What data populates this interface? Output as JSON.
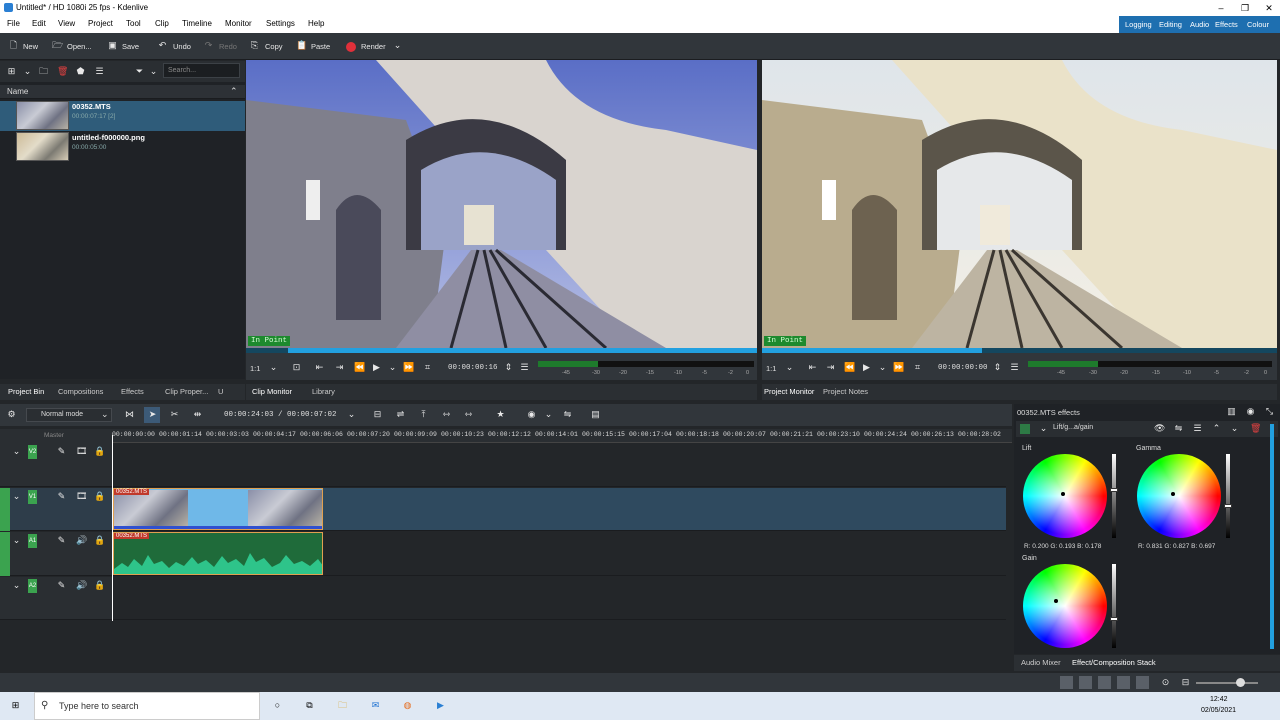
{
  "window": {
    "title": "Untitled* / HD 1080i 25 fps - Kdenlive"
  },
  "menu": [
    "File",
    "Edit",
    "View",
    "Project",
    "Tool",
    "Clip",
    "Timeline",
    "Monitor",
    "Settings",
    "Help"
  ],
  "layouts": [
    "Logging",
    "Editing",
    "Audio",
    "Effects",
    "Colour"
  ],
  "toolbar": {
    "new": "New",
    "open": "Open...",
    "save": "Save",
    "undo": "Undo",
    "redo": "Redo",
    "copy": "Copy",
    "paste": "Paste",
    "render": "Render"
  },
  "bin": {
    "search_placeholder": "Search...",
    "header": "Name",
    "items": [
      {
        "name": "00352.MTS",
        "sub": "00:00:07:17 [2]"
      },
      {
        "name": "untitled-f000000.png",
        "sub": "00:00:05:00"
      }
    ]
  },
  "clip_monitor": {
    "overlay": "In Point",
    "zoom": "1:1",
    "timecode": "00:00:00:16",
    "scale": [
      "-45",
      "-30",
      "-20",
      "-15",
      "-10",
      "-5",
      "-2",
      "0"
    ]
  },
  "project_monitor": {
    "overlay": "In Point",
    "zoom": "1:1",
    "timecode": "00:00:00:00",
    "scale": [
      "-45",
      "-30",
      "-20",
      "-15",
      "-10",
      "-5",
      "-2",
      "0"
    ]
  },
  "left_tabs": [
    "Project Bin",
    "Compositions",
    "Effects",
    "Clip Proper...",
    "U"
  ],
  "clip_tabs": [
    "Clip Monitor",
    "Library"
  ],
  "proj_tabs": [
    "Project Monitor",
    "Project Notes"
  ],
  "timeline": {
    "mode": "Normal mode",
    "position": "00:00:24:03 / 00:00:07:02",
    "master": "Master",
    "ruler": [
      "00:00:00:00",
      "00:00:01:14",
      "00:00:03:03",
      "00:00:04:17",
      "00:00:06:06",
      "00:00:07:20",
      "00:00:09:09",
      "00:00:10:23",
      "00:00:12:12",
      "00:00:14:01",
      "00:00:15:15",
      "00:00:17:04",
      "00:00:18:18",
      "00:00:20:07",
      "00:00:21:21",
      "00:00:23:10",
      "00:00:24:24",
      "00:00:26:13",
      "00:00:28:02"
    ],
    "tracks": [
      {
        "label": "V2"
      },
      {
        "label": "V1"
      },
      {
        "label": "A1"
      },
      {
        "label": "A2"
      }
    ],
    "clip_video_name": "00352.MTS",
    "clip_audio_name": "00352.MTS"
  },
  "effects": {
    "title": "00352.MTS effects",
    "effect_name": "Lift/g...a/gain",
    "lift": {
      "label": "Lift",
      "values": "R: 0.200  G: 0.193  B: 0.178"
    },
    "gamma": {
      "label": "Gamma",
      "values": "R: 0.831  G: 0.827  B: 0.697"
    },
    "gain": {
      "label": "Gain"
    },
    "tabs": [
      "Audio Mixer",
      "Effect/Composition Stack"
    ]
  },
  "taskbar": {
    "search_placeholder": "Type here to search",
    "time": "12:42",
    "date": "02/05/2021"
  },
  "colors": {
    "accent": "#1e6fb0",
    "track_video": "#2f4a5f",
    "clip_audio": "#1f6b3a",
    "inpoint": "#1d8a2e"
  }
}
